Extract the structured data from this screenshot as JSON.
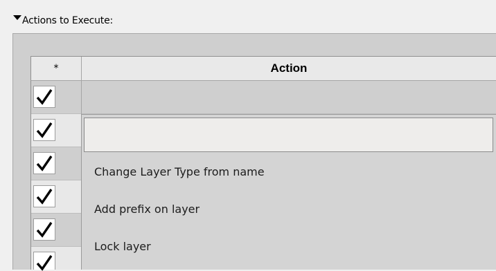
{
  "section": {
    "title": "Actions to Execute:",
    "expanded": true,
    "arrow_icon": "triangle-down-icon"
  },
  "table": {
    "columns": [
      "*",
      "Action"
    ],
    "rows": [
      {
        "checked": true,
        "action": ""
      },
      {
        "checked": true,
        "action": ""
      },
      {
        "checked": true,
        "action": ""
      },
      {
        "checked": true,
        "action": ""
      },
      {
        "checked": true,
        "action": ""
      },
      {
        "checked": true,
        "action": ""
      }
    ]
  },
  "dropdown": {
    "current_value": "",
    "options": [
      "Change Layer Type from name",
      "Add prefix on layer",
      "Lock layer"
    ]
  },
  "colors": {
    "panel": "#cfcfcf",
    "header": "#e9e9e9",
    "dropdown": "#d4d4d4",
    "field": "#eeedeb"
  }
}
